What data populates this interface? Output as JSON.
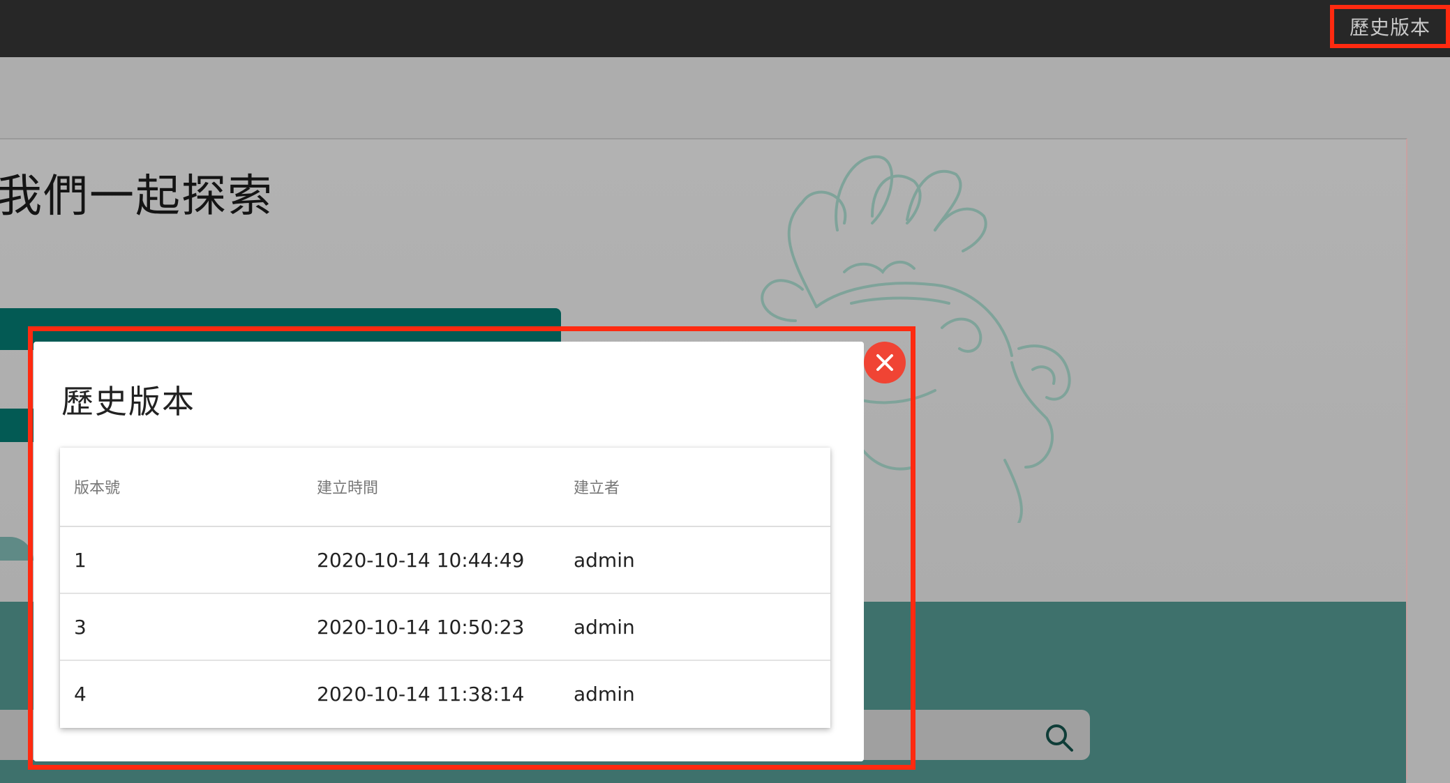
{
  "topbar": {
    "history_label": "歷史版本"
  },
  "hero": {
    "heading": "我們一起探索"
  },
  "modal": {
    "title": "歷史版本",
    "columns": [
      "版本號",
      "建立時間",
      "建立者"
    ],
    "rows": [
      {
        "version": "1",
        "created": "2020-10-14 10:44:49",
        "creator": "admin"
      },
      {
        "version": "3",
        "created": "2020-10-14 10:50:23",
        "creator": "admin"
      },
      {
        "version": "4",
        "created": "2020-10-14 11:38:14",
        "creator": "admin"
      }
    ]
  },
  "colors": {
    "highlight": "#ff2a10",
    "close": "#f04434",
    "teal": "#3e716c",
    "dark_teal": "#035a54"
  },
  "icons": {
    "close": "close-icon",
    "search": "search-icon"
  }
}
